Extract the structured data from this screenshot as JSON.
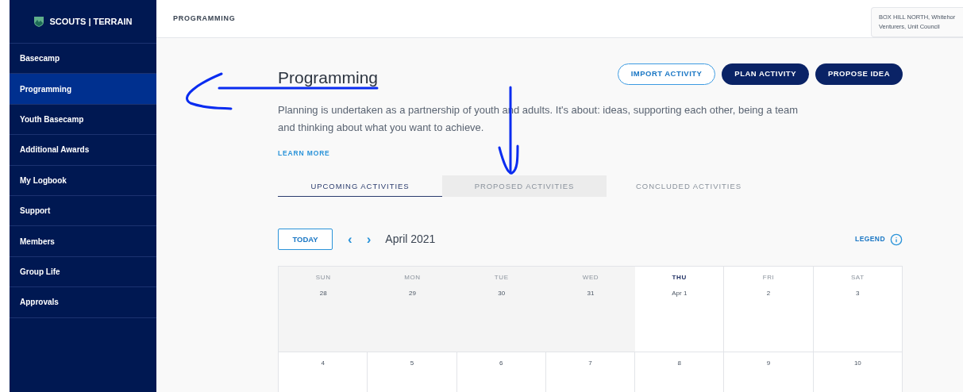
{
  "sidebar": {
    "logo": "SCOUTS | TERRAIN",
    "items": [
      {
        "label": "Basecamp",
        "selected": false
      },
      {
        "label": "Programming",
        "selected": true
      },
      {
        "label": "Youth Basecamp",
        "selected": false
      },
      {
        "label": "Additional Awards",
        "selected": false
      },
      {
        "label": "My Logbook",
        "selected": false
      },
      {
        "label": "Support",
        "selected": false
      },
      {
        "label": "Members",
        "selected": false
      },
      {
        "label": "Group Life",
        "selected": false
      },
      {
        "label": "Approvals",
        "selected": false
      }
    ]
  },
  "header": {
    "title": "PROGRAMMING",
    "unit_lines": [
      "BOX HILL NORTH, Whitehor",
      "Venturers, Unit Council"
    ]
  },
  "page": {
    "title": "Programming",
    "description": "Planning is undertaken as a partnership of youth and adults. It's about: ideas, supporting each other, being a team and thinking about what you want to achieve.",
    "learn_more": "LEARN MORE",
    "buttons": [
      {
        "label": "IMPORT ACTIVITY",
        "kind": "outline"
      },
      {
        "label": "PLAN ACTIVITY",
        "kind": "solid"
      },
      {
        "label": "PROPOSE IDEA",
        "kind": "solid"
      }
    ]
  },
  "tabs": [
    {
      "label": "UPCOMING ACTIVITIES",
      "selected": true,
      "highlighted": false
    },
    {
      "label": "PROPOSED ACTIVITIES",
      "selected": false,
      "highlighted": true
    },
    {
      "label": "CONCLUDED ACTIVITIES",
      "selected": false,
      "highlighted": false
    }
  ],
  "calendar": {
    "today_button": "TODAY",
    "prev": "‹",
    "next": "›",
    "month": "April 2021",
    "legend": "LEGEND",
    "weekdays": [
      {
        "label": "SUN",
        "today": false
      },
      {
        "label": "MON",
        "today": false
      },
      {
        "label": "TUE",
        "today": false
      },
      {
        "label": "WED",
        "today": false
      },
      {
        "label": "THU",
        "today": true
      },
      {
        "label": "FRI",
        "today": false
      },
      {
        "label": "SAT",
        "today": false
      }
    ],
    "weeks": [
      [
        {
          "date": "28",
          "past": true
        },
        {
          "date": "29",
          "past": true
        },
        {
          "date": "30",
          "past": true
        },
        {
          "date": "31",
          "past": true
        },
        {
          "date": "Apr 1",
          "past": false
        },
        {
          "date": "2",
          "past": false
        },
        {
          "date": "3",
          "past": false
        }
      ],
      [
        {
          "date": "4",
          "past": false
        },
        {
          "date": "5",
          "past": false
        },
        {
          "date": "6",
          "past": false
        },
        {
          "date": "7",
          "past": false
        },
        {
          "date": "8",
          "past": false
        },
        {
          "date": "9",
          "past": false
        },
        {
          "date": "10",
          "past": false
        }
      ]
    ]
  }
}
